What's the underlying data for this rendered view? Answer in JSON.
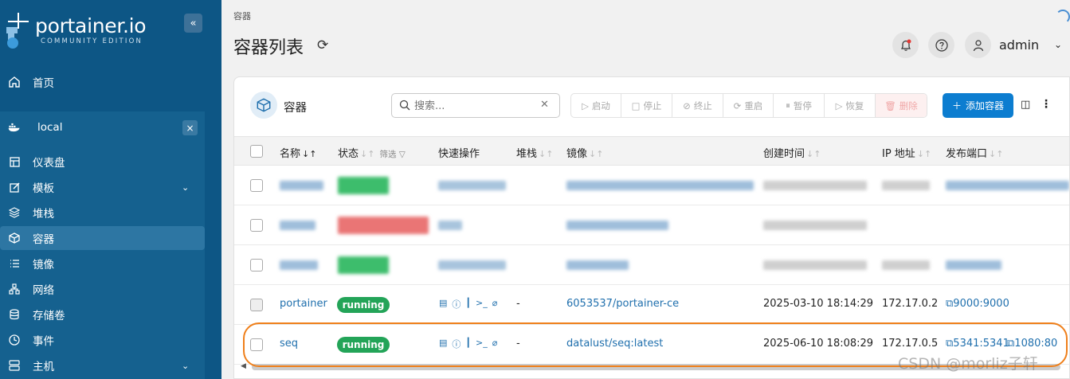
{
  "sidebar": {
    "logo_text": "portainer.io",
    "logo_sub": "COMMUNITY EDITION",
    "collapse_icon": "«",
    "home_label": "首页",
    "env_name": "local",
    "env_close": "×",
    "items": [
      {
        "label": "仪表盘",
        "icon": "dashboard-icon"
      },
      {
        "label": "模板",
        "icon": "edit-icon",
        "chevron": true
      },
      {
        "label": "堆栈",
        "icon": "layers-icon"
      },
      {
        "label": "容器",
        "icon": "box-icon",
        "active": true
      },
      {
        "label": "镜像",
        "icon": "list-icon"
      },
      {
        "label": "网络",
        "icon": "network-icon"
      },
      {
        "label": "存储卷",
        "icon": "database-icon"
      },
      {
        "label": "事件",
        "icon": "clock-icon"
      },
      {
        "label": "主机",
        "icon": "server-icon",
        "chevron": true
      }
    ]
  },
  "header": {
    "breadcrumb": "容器",
    "title": "容器列表",
    "user": "admin"
  },
  "card": {
    "title": "容器",
    "search_placeholder": "搜索...",
    "actions": [
      {
        "label": "启动",
        "icon": "play-icon"
      },
      {
        "label": "停止",
        "icon": "stop-icon"
      },
      {
        "label": "终止",
        "icon": "ban-icon"
      },
      {
        "label": "重启",
        "icon": "restart-icon"
      },
      {
        "label": "暂停",
        "icon": "pause-icon"
      },
      {
        "label": "恢复",
        "icon": "resume-icon"
      },
      {
        "label": "删除",
        "icon": "trash-icon"
      }
    ],
    "add_label": "添加容器"
  },
  "table": {
    "columns": [
      "名称",
      "状态",
      "快速操作",
      "堆栈",
      "镜像",
      "创建时间",
      "IP 地址",
      "发布端口"
    ],
    "filter_label": "筛选",
    "rows": [
      {
        "name": "portainer",
        "status": "running",
        "stack": "-",
        "image": "6053537/portainer-ce",
        "created": "2025-03-10 18:14:29",
        "ip": "172.17.0.2",
        "ports": [
          "9000:9000"
        ]
      },
      {
        "name": "seq",
        "status": "running",
        "stack": "-",
        "image": "datalust/seq:latest",
        "created": "2025-06-10 18:08:29",
        "ip": "172.17.0.5",
        "ports": [
          "5341:5341",
          "1080:80"
        ]
      }
    ]
  },
  "watermark": "CSDN @morliz子轩",
  "colors": {
    "sidebar": "#0d5685",
    "running": "#23a458",
    "link": "#1f6fad",
    "highlight": "#ef7f1a",
    "primary": "#0c7dd0"
  }
}
